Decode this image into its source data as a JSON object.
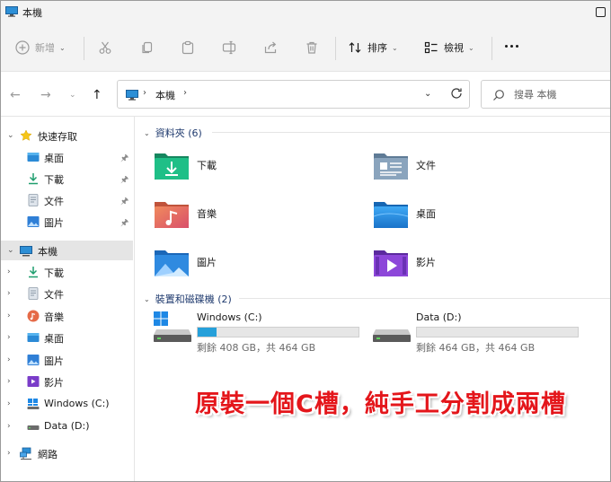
{
  "window": {
    "title": "本機"
  },
  "toolbar": {
    "new_label": "新增",
    "sort_label": "排序",
    "view_label": "檢視"
  },
  "address": {
    "crumb": "本機"
  },
  "search": {
    "placeholder": "搜尋 本機"
  },
  "sidebar": {
    "quick_access": "快速存取",
    "quick_items": [
      {
        "label": "桌面",
        "icon": "desktop-icon"
      },
      {
        "label": "下載",
        "icon": "download-icon"
      },
      {
        "label": "文件",
        "icon": "documents-icon"
      },
      {
        "label": "圖片",
        "icon": "pictures-icon"
      }
    ],
    "this_pc": "本機",
    "pc_items": [
      {
        "label": "下載",
        "icon": "download-icon"
      },
      {
        "label": "文件",
        "icon": "documents-icon"
      },
      {
        "label": "音樂",
        "icon": "music-icon"
      },
      {
        "label": "桌面",
        "icon": "desktop-icon"
      },
      {
        "label": "圖片",
        "icon": "pictures-icon"
      },
      {
        "label": "影片",
        "icon": "videos-icon"
      },
      {
        "label": "Windows (C:)",
        "icon": "windows-drive-icon"
      },
      {
        "label": "Data (D:)",
        "icon": "drive-icon"
      }
    ],
    "network": "網路"
  },
  "main": {
    "folders_header": "資料夾 (6)",
    "folders": [
      {
        "name": "下載",
        "icon": "download-folder-icon"
      },
      {
        "name": "文件",
        "icon": "documents-folder-icon"
      },
      {
        "name": "音樂",
        "icon": "music-folder-icon"
      },
      {
        "name": "桌面",
        "icon": "desktop-folder-icon"
      },
      {
        "name": "圖片",
        "icon": "pictures-folder-icon"
      },
      {
        "name": "影片",
        "icon": "videos-folder-icon"
      }
    ],
    "drives_header": "裝置和磁碟機 (2)",
    "drives": [
      {
        "name": "Windows (C:)",
        "info": "剩餘 408 GB，共 464 GB",
        "used_fraction": 0.12,
        "icon": "windows-drive-icon"
      },
      {
        "name": "Data (D:)",
        "info": "剩餘 464 GB，共 464 GB",
        "used_fraction": 0.0,
        "icon": "drive-icon"
      }
    ]
  },
  "overlay": {
    "text": "原裝一個C槽，純手工分割成兩槽"
  },
  "colors": {
    "accent": "#26a0da",
    "overlay_red": "#e4161b",
    "selected_bg": "#e5e5e5"
  }
}
